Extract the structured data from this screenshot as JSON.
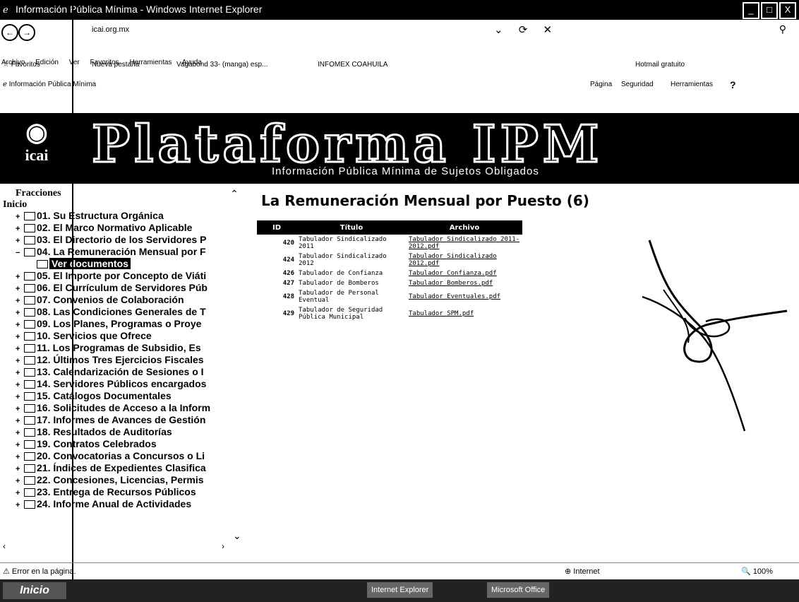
{
  "window": {
    "title": "Información Pública Mínima - Windows Internet Explorer",
    "controls": [
      "_",
      "□",
      "X"
    ]
  },
  "address": {
    "url": "icai.org.mx",
    "controls": "⌄ ⟳ ✕"
  },
  "menu": [
    "Archivo",
    "Edición",
    "Ver",
    "Favoritos",
    "Herramientas",
    "Ayuda"
  ],
  "favorites": {
    "label": "Favoritos",
    "items": [
      "Nueva pestaña",
      "Vagabond 33- (manga) esp...",
      "INFOMEX COAHUILA",
      "Hotmail gratuito"
    ]
  },
  "tab": {
    "label": "Información Pública Mínima"
  },
  "commandbar": [
    "Página",
    "Seguridad",
    "Herramientas"
  ],
  "banner": {
    "logo": "icai",
    "title": "Plataforma IPM",
    "subtitle": "Información Pública Mínima de Sujetos Obligados"
  },
  "sidebar": {
    "header": "Fracciones",
    "header2": "Inicio",
    "items": [
      {
        "label": "01. Su Estructura Orgánica"
      },
      {
        "label": "02. El Marco Normativo Aplicable"
      },
      {
        "label": "03. El Directorio de los Servidores P"
      },
      {
        "label": "04. La Remuneración Mensual por F"
      },
      {
        "label": "Ver documentos",
        "sub": true
      },
      {
        "label": "05. El Importe por Concepto de Viáti"
      },
      {
        "label": "06. El Currículum de Servidores Púb"
      },
      {
        "label": "07. Convenios de Colaboración"
      },
      {
        "label": "08. Las Condiciones Generales de T"
      },
      {
        "label": "09. Los Planes, Programas o Proye"
      },
      {
        "label": "10. Servicios que Ofrece"
      },
      {
        "label": "11. Los Programas de Subsidio, Es"
      },
      {
        "label": "12. Últimos Tres Ejercicios Fiscales"
      },
      {
        "label": "13. Calendarización de Sesiones o I"
      },
      {
        "label": "14. Servidores Públicos encargados"
      },
      {
        "label": "15. Catálogos Documentales"
      },
      {
        "label": "16. Solicitudes de Acceso a la Inform"
      },
      {
        "label": "17. Informes de Avances de Gestión"
      },
      {
        "label": "18. Resultados de Auditorías"
      },
      {
        "label": "19. Contratos Celebrados"
      },
      {
        "label": "20. Convocatorias a Concursos o Li"
      },
      {
        "label": "21. Índices de Expedientes Clasifica"
      },
      {
        "label": "22. Concesiones, Licencias, Permis"
      },
      {
        "label": "23. Entrega de Recursos Públicos"
      },
      {
        "label": "24. Informe Anual de Actividades"
      }
    ]
  },
  "main": {
    "title": "La Remuneración Mensual por Puesto (6)",
    "table": {
      "headers": [
        "ID",
        "Título",
        "Archivo"
      ],
      "rows": [
        {
          "id": "420",
          "title": "Tabulador Sindicalizado 2011",
          "file": "Tabulador Sindicalizado 2011-2012.pdf"
        },
        {
          "id": "424",
          "title": "Tabulador Sindicalizado 2012",
          "file": "Tabulador Sindicalizado 2012.pdf"
        },
        {
          "id": "426",
          "title": "Tabulador de Confianza",
          "file": "Tabulador Confianza.pdf"
        },
        {
          "id": "427",
          "title": "Tabulador de Bomberos",
          "file": "Tabulador Bomberos.pdf"
        },
        {
          "id": "428",
          "title": "Tabulador de Personal Eventual",
          "file": "Tabulador Eventuales.pdf"
        },
        {
          "id": "429",
          "title": "Tabulador de Seguridad Pública Municipal",
          "file": "Tabulador SPM.pdf"
        }
      ]
    }
  },
  "status": {
    "left": "Error en la página.",
    "zone": "Internet",
    "zoom": "100%"
  },
  "taskbar": {
    "start": "Inicio",
    "items": [
      "Internet Explorer",
      "Microsoft Office"
    ]
  }
}
